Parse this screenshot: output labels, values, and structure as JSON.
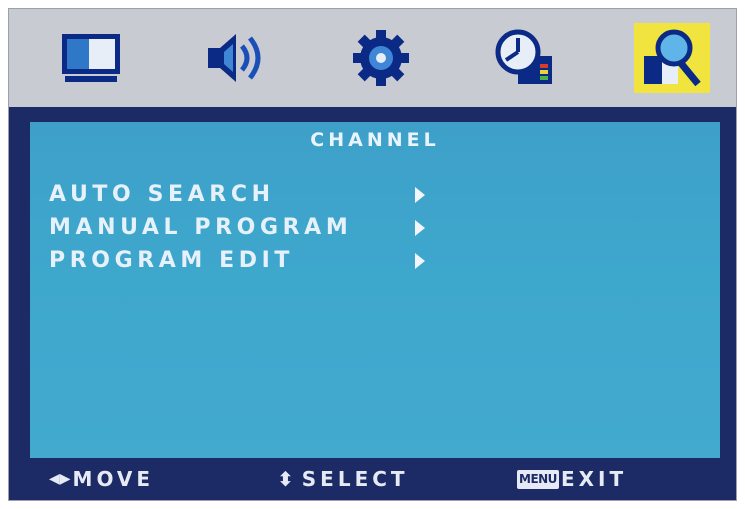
{
  "tabs": [
    {
      "icon": "picture-icon",
      "active": false
    },
    {
      "icon": "speaker-icon",
      "active": false
    },
    {
      "icon": "gear-icon",
      "active": false
    },
    {
      "icon": "clock-icon",
      "active": false
    },
    {
      "icon": "channel-search-icon",
      "active": true
    }
  ],
  "panel": {
    "title": "CHANNEL",
    "items": [
      {
        "label": "AUTO SEARCH"
      },
      {
        "label": "MANUAL PROGRAM"
      },
      {
        "label": "PROGRAM EDIT"
      }
    ]
  },
  "footer": {
    "move_glyph": "◀▶",
    "move_label": "MOVE",
    "select_glyph": "⬍",
    "select_label": "SELECT",
    "menu_key": "MENU",
    "exit_label": "EXIT"
  },
  "colors": {
    "frame": "#1c2a66",
    "topbar": "#c9cbd3",
    "panel": "#3ea7cc",
    "active_tab": "#f2e43f"
  }
}
